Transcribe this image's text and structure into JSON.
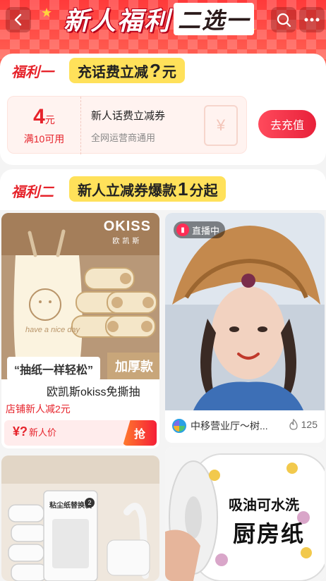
{
  "header": {
    "title_main": "新人福利",
    "title_rest": "二选一",
    "back_icon": "chevron-left-icon",
    "search_icon": "search-icon",
    "more_icon": "more-dots-icon"
  },
  "benefit1": {
    "tag": "福利一",
    "slogan_pre": "充话费立减",
    "slogan_mark": "?",
    "slogan_post": "元",
    "coupon": {
      "amount": "4",
      "unit": "元",
      "condition": "满10可用",
      "name": "新人话费立减券",
      "subtitle": "全网运营商通用"
    },
    "button": "去充值"
  },
  "benefit2": {
    "tag": "福利二",
    "slogan_pre": "新人立减券爆款",
    "slogan_mark": "1",
    "slogan_post": "分起"
  },
  "products": [
    {
      "brand": "OKISS",
      "brand_cn": "欧凯斯",
      "banner_left": "“抽纸一样轻松”",
      "banner_right": "加厚款",
      "bag_text": "have a nice day",
      "name": "欧凯斯okiss免撕抽",
      "promo": "店铺新人减2元",
      "price_symbol": "¥",
      "price_value": "?",
      "price_label": "新人价",
      "action": "抢"
    },
    {
      "live_label": "直播中",
      "shop_name": "中移营业厅～树...",
      "likes": "125"
    },
    {
      "pack_label": "粘尘纸替换装",
      "pack_number": "2"
    },
    {
      "line1": "吸油可水洗",
      "line2": "厨房纸"
    }
  ],
  "colors": {
    "brand_red": "#e6232b",
    "yellow": "#ffe15a",
    "header_red": "#ff3a3a"
  }
}
